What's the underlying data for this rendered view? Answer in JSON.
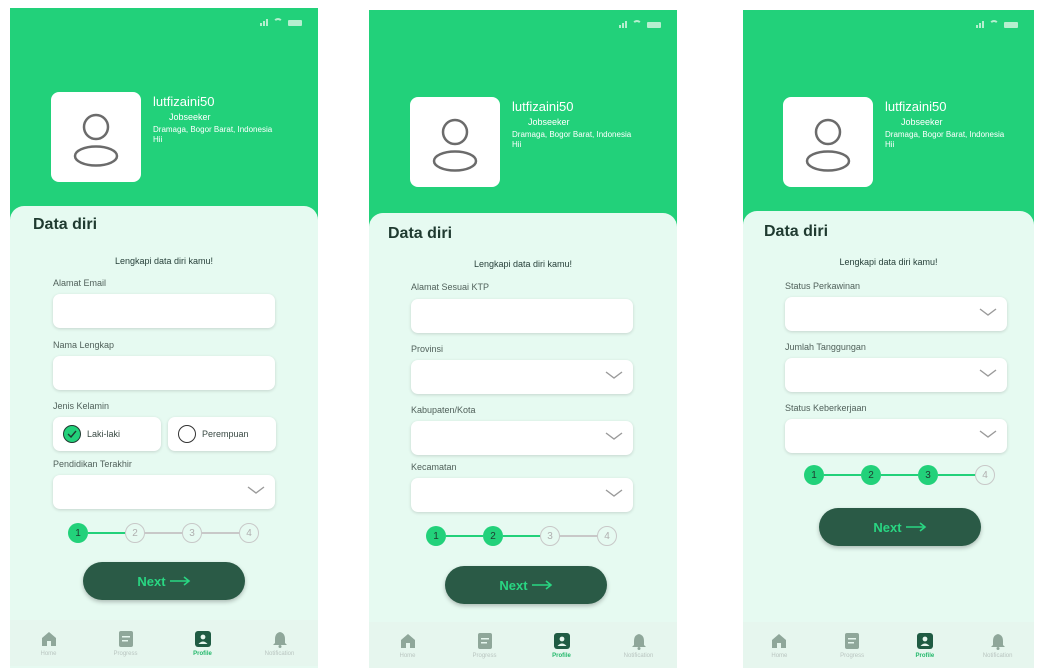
{
  "colors": {
    "brand": "#22d17a",
    "dark_green": "#2a5a46",
    "panel": "#e6faf1",
    "active_nav": "#22b86a"
  },
  "screens": [
    {
      "user": {
        "name": "lutfizaini50",
        "role": "Jobseeker",
        "location": "Dramaga, Bogor Barat, Indonesia",
        "bio": "Hii"
      },
      "title": "Data diri",
      "subtitle": "Lengkapi data diri kamu!",
      "fields": {
        "email_label": "Alamat Email",
        "email_value": "",
        "name_label": "Nama Lengkap",
        "name_value": "",
        "gender_label": "Jenis Kelamin",
        "gender_male": "Laki-laki",
        "gender_female": "Perempuan",
        "gender_selected": "Laki-laki",
        "education_label": "Pendidikan Terakhir",
        "education_value": ""
      },
      "steps": [
        "1",
        "2",
        "3",
        "4"
      ],
      "active_step": 1,
      "next_label": "Next"
    },
    {
      "user": {
        "name": "lutfizaini50",
        "role": "Jobseeker",
        "location": "Dramaga, Bogor Barat, Indonesia",
        "bio": "Hii"
      },
      "title": "Data diri",
      "subtitle": "Lengkapi data diri kamu!",
      "fields": {
        "address_label": "Alamat Sesuai KTP",
        "address_value": "",
        "province_label": "Provinsi",
        "province_value": "",
        "city_label": "Kabupaten/Kota",
        "city_value": "",
        "district_label": "Kecamatan",
        "district_value": ""
      },
      "steps": [
        "1",
        "2",
        "3",
        "4"
      ],
      "active_step": 2,
      "next_label": "Next"
    },
    {
      "user": {
        "name": "lutfizaini50",
        "role": "Jobseeker",
        "location": "Dramaga, Bogor Barat, Indonesia",
        "bio": "Hii"
      },
      "title": "Data diri",
      "subtitle": "Lengkapi data diri kamu!",
      "fields": {
        "marital_label": "Status Perkawinan",
        "marital_value": "",
        "dependents_label": "Jumlah Tanggungan",
        "dependents_value": "",
        "employment_label": "Status Keberkerjaan",
        "employment_value": ""
      },
      "steps": [
        "1",
        "2",
        "3",
        "4"
      ],
      "active_step": 3,
      "next_label": "Next"
    }
  ],
  "nav": [
    {
      "label": "Home",
      "icon": "home-icon"
    },
    {
      "label": "Progress",
      "icon": "document-icon"
    },
    {
      "label": "Profile",
      "icon": "profile-icon",
      "active": true
    },
    {
      "label": "Notification",
      "icon": "bell-icon"
    }
  ]
}
